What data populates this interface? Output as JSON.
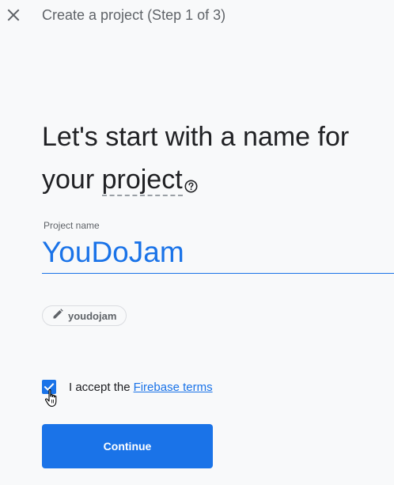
{
  "header": {
    "close_icon": "close-icon",
    "title": "Create a project (Step 1 of 3)"
  },
  "main": {
    "heading_part1": "Let's start with a name for your",
    "heading_project_word": "project",
    "help_icon": "help-circle-icon"
  },
  "project_field": {
    "label": "Project name",
    "value": "YouDoJam"
  },
  "project_id_chip": {
    "icon": "pencil-icon",
    "text": "youdojam"
  },
  "terms": {
    "checked": true,
    "text": "I accept the",
    "link_text": "Firebase terms"
  },
  "actions": {
    "continue_label": "Continue"
  },
  "colors": {
    "accent": "#1a73e8",
    "background": "#f8f9fa",
    "text_primary": "#202124",
    "text_secondary": "#5f6368"
  }
}
